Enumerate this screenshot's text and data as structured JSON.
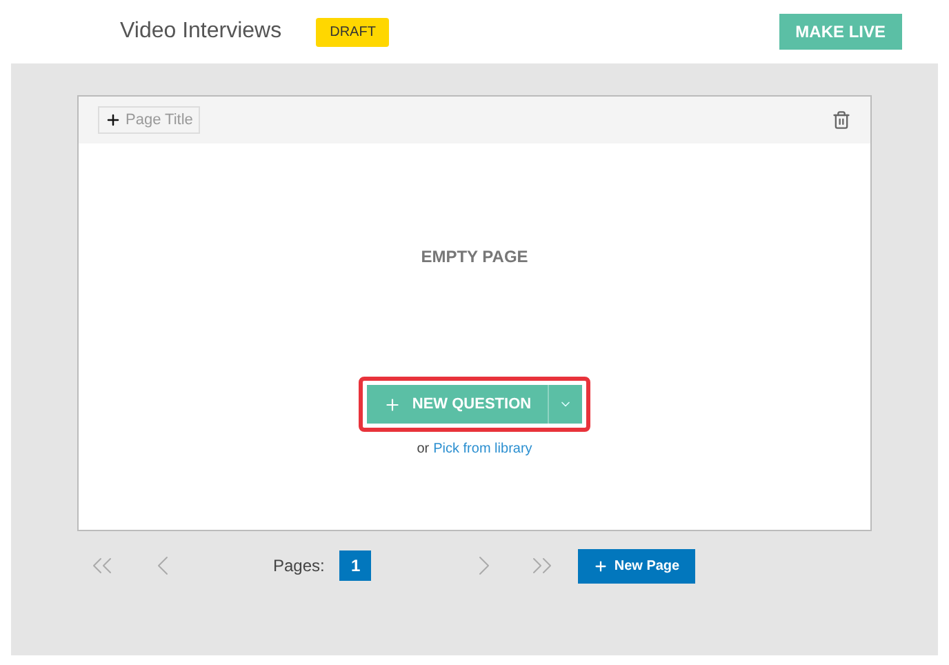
{
  "header": {
    "title": "Video Interviews",
    "status_badge": "DRAFT",
    "make_live_button": "MAKE LIVE"
  },
  "page": {
    "title_button": "Page Title",
    "empty_label": "EMPTY PAGE",
    "new_question_button": "NEW QUESTION",
    "highlighted": true,
    "library_prefix": "or",
    "library_link": "Pick from library"
  },
  "pagination": {
    "label": "Pages:",
    "pages": [
      {
        "label": "1",
        "selected": true
      }
    ],
    "new_page_button": "New Page"
  }
}
